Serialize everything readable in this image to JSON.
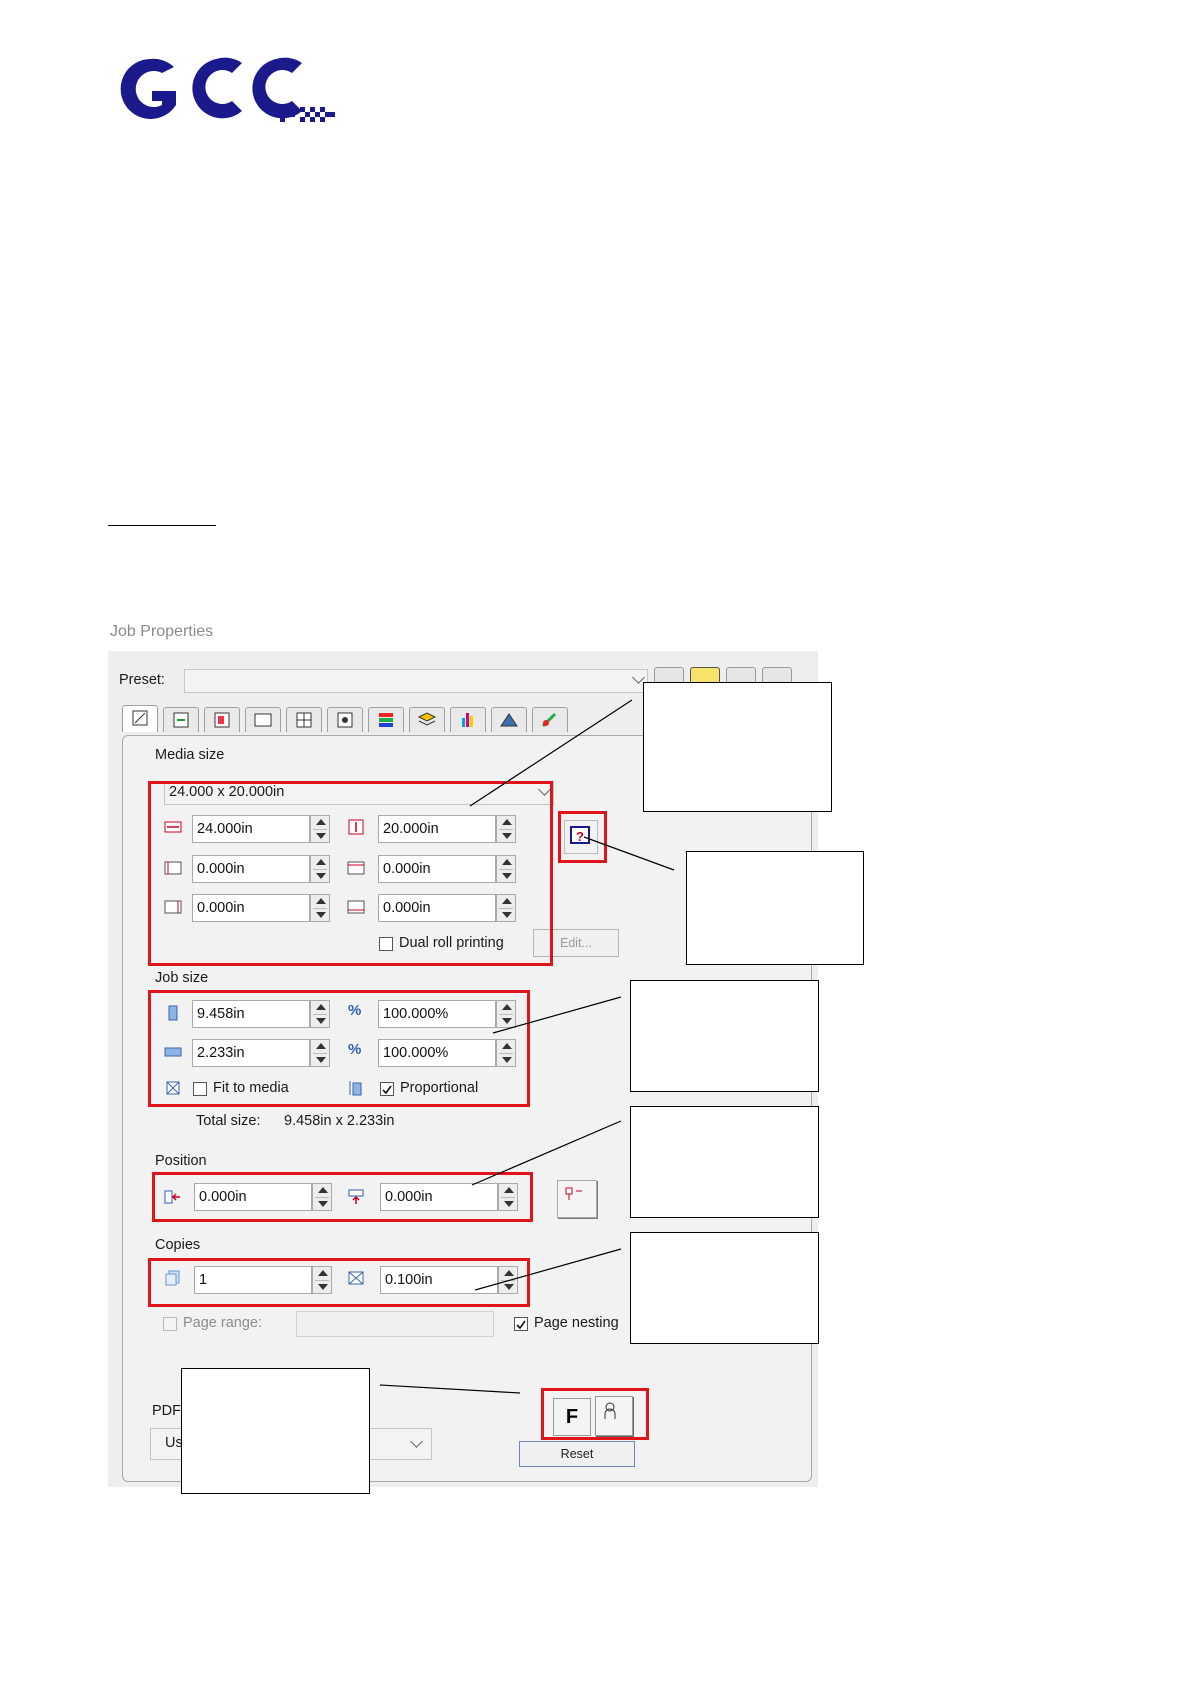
{
  "logo": {
    "text": "GCC",
    "colors": {
      "brand": "#1b1a8c"
    }
  },
  "caption": "Job Properties",
  "preset": {
    "label": "Preset:",
    "value": ""
  },
  "media": {
    "section": "Media size",
    "dropdown_value": "24.000 x 20.000in",
    "width": "24.000in",
    "height": "20.000in",
    "left": "0.000in",
    "top": "0.000in",
    "right": "0.000in",
    "bottom": "0.000in",
    "dual_roll_label": "Dual roll printing",
    "edit_label": "Edit..."
  },
  "job": {
    "section": "Job size",
    "width": "9.458in",
    "height": "2.233in",
    "width_pct": "100.000%",
    "height_pct": "100.000%",
    "pct_symbol": "%",
    "fit_label": "Fit to media",
    "proportional_label": "Proportional",
    "total_label": "Total size:",
    "total_value": "9.458in x 2.233in"
  },
  "position": {
    "section": "Position",
    "x": "0.000in",
    "y": "0.000in"
  },
  "copies": {
    "section": "Copies",
    "count": "1",
    "spacing": "0.100in",
    "page_range_label": "Page range:",
    "page_nesting_label": "Page nesting"
  },
  "pdf": {
    "label": "PDF",
    "select_fragment": "Us"
  },
  "bottom": {
    "f_label": "F",
    "reset_label": "Reset"
  },
  "colors": {
    "highlight": "#e0151b"
  }
}
